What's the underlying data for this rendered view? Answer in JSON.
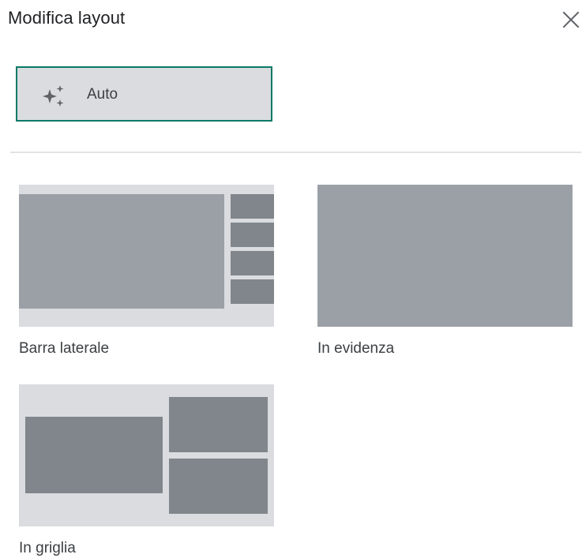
{
  "dialog": {
    "title": "Modifica layout",
    "close_icon": "close-icon"
  },
  "auto_option": {
    "label": "Auto",
    "icon": "sparkle-icon",
    "selected": true,
    "border_color": "#0b7a66"
  },
  "layout_options": [
    {
      "id": "sidebar",
      "label": "Barra laterale"
    },
    {
      "id": "spotlight",
      "label": "In evidenza"
    },
    {
      "id": "tiled",
      "label": "In griglia"
    }
  ],
  "colors": {
    "thumb_background": "#dadce0",
    "main_tile": "#9aa0a6",
    "secondary_tile": "#80868b"
  }
}
